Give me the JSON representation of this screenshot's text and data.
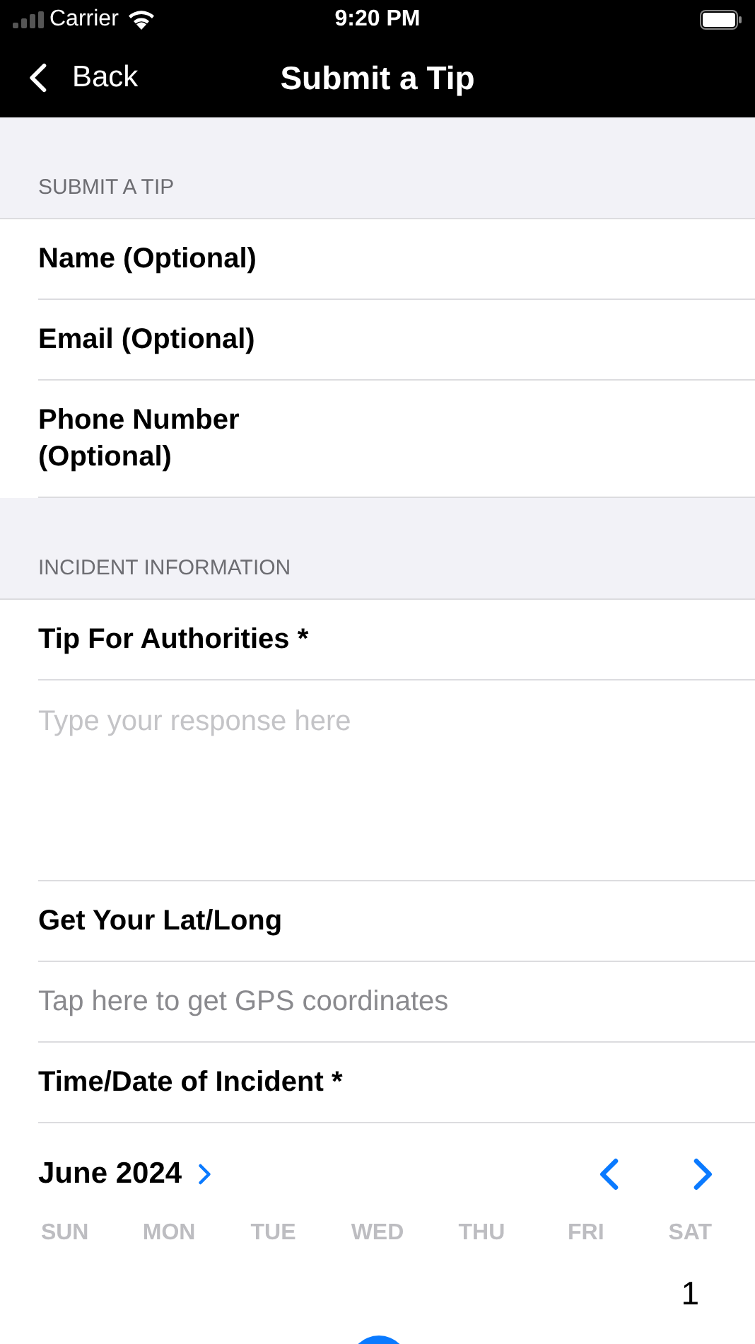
{
  "status_bar": {
    "carrier": "Carrier",
    "time": "9:20 PM"
  },
  "nav": {
    "back": "Back",
    "title": "Submit a Tip"
  },
  "sections": [
    {
      "header": "SUBMIT A TIP",
      "rows": [
        {
          "kind": "label",
          "text": "Name (Optional)"
        },
        {
          "kind": "label",
          "text": "Email (Optional)"
        },
        {
          "kind": "label",
          "text": "Phone Number (Optional)"
        }
      ]
    },
    {
      "header": "INCIDENT INFORMATION",
      "rows": [
        {
          "kind": "label",
          "text": "Tip For Authorities *"
        },
        {
          "kind": "textarea",
          "placeholder": "Type your response here"
        },
        {
          "kind": "label",
          "text": "Get Your Lat/Long"
        },
        {
          "kind": "action",
          "text": "Tap here to get GPS coordinates"
        },
        {
          "kind": "label",
          "text": "Time/Date of Incident *"
        }
      ]
    }
  ],
  "calendar": {
    "month": "June 2024",
    "weekdays": [
      "SUN",
      "MON",
      "TUE",
      "WED",
      "THU",
      "FRI",
      "SAT"
    ],
    "days": [
      {
        "kind": "blank"
      },
      {
        "kind": "blank"
      },
      {
        "kind": "blank"
      },
      {
        "kind": "blank"
      },
      {
        "kind": "blank"
      },
      {
        "kind": "blank"
      },
      {
        "kind": "day",
        "text": "1"
      }
    ]
  }
}
